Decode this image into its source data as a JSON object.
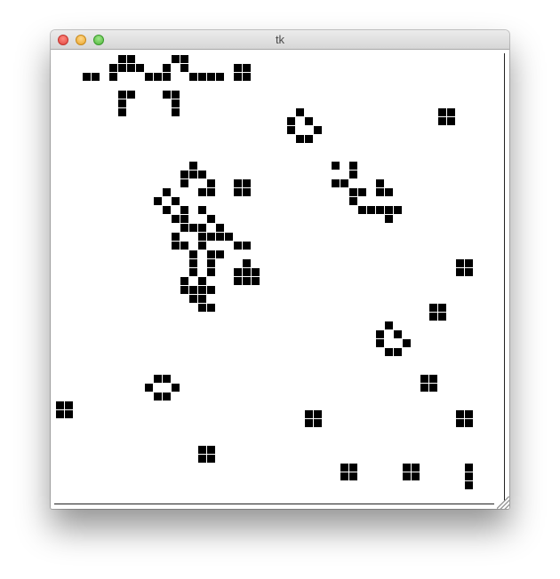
{
  "window": {
    "title": "tk",
    "controls": [
      "close-button",
      "minimize-button",
      "zoom-button"
    ]
  },
  "grid": {
    "cell_color": "#000000",
    "background": "#ffffff",
    "live_cells": [
      [
        3,
        2
      ],
      [
        4,
        2
      ],
      [
        6,
        2
      ],
      [
        12,
        2
      ],
      [
        7,
        1
      ],
      [
        8,
        1
      ],
      [
        6,
        1
      ],
      [
        9,
        1
      ],
      [
        7,
        0
      ],
      [
        8,
        0
      ],
      [
        10,
        2
      ],
      [
        11,
        2
      ],
      [
        12,
        1
      ],
      [
        13,
        0
      ],
      [
        14,
        0
      ],
      [
        14,
        1
      ],
      [
        15,
        2
      ],
      [
        16,
        2
      ],
      [
        17,
        2
      ],
      [
        18,
        2
      ],
      [
        20,
        1
      ],
      [
        21,
        1
      ],
      [
        20,
        2
      ],
      [
        21,
        2
      ],
      [
        7,
        4
      ],
      [
        8,
        4
      ],
      [
        7,
        5
      ],
      [
        7,
        6
      ],
      [
        12,
        4
      ],
      [
        13,
        4
      ],
      [
        13,
        5
      ],
      [
        13,
        6
      ],
      [
        27,
        6
      ],
      [
        28,
        7
      ],
      [
        26,
        7
      ],
      [
        26,
        8
      ],
      [
        29,
        8
      ],
      [
        27,
        9
      ],
      [
        28,
        9
      ],
      [
        43,
        6
      ],
      [
        44,
        6
      ],
      [
        43,
        7
      ],
      [
        44,
        7
      ],
      [
        15,
        12
      ],
      [
        14,
        13
      ],
      [
        15,
        13
      ],
      [
        16,
        13
      ],
      [
        14,
        14
      ],
      [
        17,
        14
      ],
      [
        16,
        15
      ],
      [
        17,
        15
      ],
      [
        20,
        14
      ],
      [
        21,
        14
      ],
      [
        20,
        15
      ],
      [
        21,
        15
      ],
      [
        12,
        15
      ],
      [
        11,
        16
      ],
      [
        13,
        16
      ],
      [
        12,
        17
      ],
      [
        14,
        17
      ],
      [
        16,
        17
      ],
      [
        13,
        18
      ],
      [
        14,
        18
      ],
      [
        17,
        18
      ],
      [
        14,
        19
      ],
      [
        15,
        19
      ],
      [
        16,
        19
      ],
      [
        18,
        19
      ],
      [
        13,
        20
      ],
      [
        16,
        20
      ],
      [
        17,
        20
      ],
      [
        18,
        20
      ],
      [
        19,
        20
      ],
      [
        13,
        21
      ],
      [
        14,
        21
      ],
      [
        16,
        21
      ],
      [
        20,
        21
      ],
      [
        21,
        21
      ],
      [
        15,
        22
      ],
      [
        17,
        22
      ],
      [
        18,
        22
      ],
      [
        15,
        23
      ],
      [
        17,
        23
      ],
      [
        21,
        23
      ],
      [
        20,
        24
      ],
      [
        21,
        24
      ],
      [
        22,
        24
      ],
      [
        15,
        24
      ],
      [
        17,
        24
      ],
      [
        20,
        25
      ],
      [
        21,
        25
      ],
      [
        22,
        25
      ],
      [
        14,
        25
      ],
      [
        16,
        25
      ],
      [
        14,
        26
      ],
      [
        15,
        26
      ],
      [
        16,
        26
      ],
      [
        17,
        26
      ],
      [
        15,
        27
      ],
      [
        16,
        27
      ],
      [
        16,
        28
      ],
      [
        17,
        28
      ],
      [
        31,
        12
      ],
      [
        33,
        12
      ],
      [
        33,
        13
      ],
      [
        31,
        14
      ],
      [
        32,
        14
      ],
      [
        33,
        15
      ],
      [
        34,
        15
      ],
      [
        33,
        16
      ],
      [
        36,
        14
      ],
      [
        36,
        15
      ],
      [
        37,
        15
      ],
      [
        34,
        17
      ],
      [
        35,
        17
      ],
      [
        36,
        17
      ],
      [
        37,
        17
      ],
      [
        38,
        17
      ],
      [
        37,
        18
      ],
      [
        45,
        23
      ],
      [
        46,
        23
      ],
      [
        45,
        24
      ],
      [
        46,
        24
      ],
      [
        42,
        28
      ],
      [
        43,
        28
      ],
      [
        42,
        29
      ],
      [
        43,
        29
      ],
      [
        37,
        30
      ],
      [
        36,
        31
      ],
      [
        38,
        31
      ],
      [
        36,
        32
      ],
      [
        39,
        32
      ],
      [
        37,
        33
      ],
      [
        38,
        33
      ],
      [
        11,
        36
      ],
      [
        12,
        36
      ],
      [
        10,
        37
      ],
      [
        13,
        37
      ],
      [
        11,
        38
      ],
      [
        12,
        38
      ],
      [
        41,
        36
      ],
      [
        42,
        36
      ],
      [
        41,
        37
      ],
      [
        42,
        37
      ],
      [
        0,
        39
      ],
      [
        1,
        39
      ],
      [
        0,
        40
      ],
      [
        1,
        40
      ],
      [
        28,
        40
      ],
      [
        29,
        40
      ],
      [
        28,
        41
      ],
      [
        29,
        41
      ],
      [
        45,
        40
      ],
      [
        46,
        40
      ],
      [
        45,
        41
      ],
      [
        46,
        41
      ],
      [
        16,
        44
      ],
      [
        17,
        44
      ],
      [
        16,
        45
      ],
      [
        17,
        45
      ],
      [
        32,
        46
      ],
      [
        33,
        46
      ],
      [
        32,
        47
      ],
      [
        33,
        47
      ],
      [
        39,
        46
      ],
      [
        40,
        46
      ],
      [
        39,
        47
      ],
      [
        40,
        47
      ],
      [
        46,
        46
      ],
      [
        46,
        47
      ],
      [
        46,
        48
      ]
    ]
  }
}
